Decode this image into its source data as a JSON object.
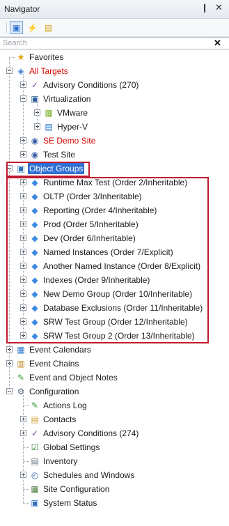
{
  "window": {
    "title": "Navigator",
    "pin_glyph": "❙",
    "close_glyph": "✕"
  },
  "toolbar": {
    "buttons": [
      {
        "name": "targets-view-icon",
        "glyph": "▣",
        "color": "#2b6fd0"
      },
      {
        "name": "lightning-icon",
        "glyph": "⚡",
        "color": "#e0a100"
      },
      {
        "name": "notes-icon",
        "glyph": "▤",
        "color": "#d9a21b"
      }
    ]
  },
  "search": {
    "placeholder": "Search",
    "clear_glyph": "✕"
  },
  "tree": [
    {
      "label": "Favorites",
      "icon": "favorites-icon",
      "glyph": "★",
      "glyph_color": "#e0a100"
    },
    {
      "label": "All Targets",
      "icon": "all-targets-icon",
      "glyph": "◈",
      "glyph_color": "#3a7bd5",
      "red": true
    },
    {
      "label": "Advisory Conditions (270)",
      "icon": "advisory-conditions-icon",
      "glyph": "✓",
      "glyph_color": "#7c4ca8"
    },
    {
      "label": "Virtualization",
      "icon": "virtualization-icon",
      "glyph": "▣",
      "glyph_color": "#2a5d9c"
    },
    {
      "label": "VMware",
      "icon": "vmware-icon",
      "glyph": "▦",
      "glyph_color": "#7bb12b"
    },
    {
      "label": "Hyper-V",
      "icon": "hyperv-icon",
      "glyph": "▤",
      "glyph_color": "#1e74c8"
    },
    {
      "label": "SE Demo Site",
      "icon": "site-icon",
      "glyph": "◉",
      "glyph_color": "#3b5fa8",
      "red": true
    },
    {
      "label": "Test Site",
      "icon": "site-icon",
      "glyph": "◉",
      "glyph_color": "#3b5fa8"
    },
    {
      "label": "Object Groups",
      "icon": "object-groups-icon",
      "glyph": "▣",
      "glyph_color": "#2d6fbf"
    },
    {
      "label": "Runtime Max Test (Order 2/Inheritable)",
      "icon": "object-group-icon",
      "glyph": "◆",
      "glyph_color": "#3d8be0"
    },
    {
      "label": "OLTP (Order 3/Inheritable)",
      "icon": "object-group-icon",
      "glyph": "◆",
      "glyph_color": "#3d8be0"
    },
    {
      "label": "Reporting (Order 4/Inheritable)",
      "icon": "object-group-icon",
      "glyph": "◆",
      "glyph_color": "#3d8be0"
    },
    {
      "label": "Prod (Order 5/Inheritable)",
      "icon": "object-group-icon",
      "glyph": "◆",
      "glyph_color": "#3d8be0"
    },
    {
      "label": "Dev (Order 6/Inheritable)",
      "icon": "object-group-icon",
      "glyph": "◆",
      "glyph_color": "#3d8be0"
    },
    {
      "label": "Named Instances (Order 7/Explicit)",
      "icon": "object-group-icon",
      "glyph": "◆",
      "glyph_color": "#3d8be0"
    },
    {
      "label": "Another Named Instance (Order 8/Explicit)",
      "icon": "object-group-icon",
      "glyph": "◆",
      "glyph_color": "#3d8be0"
    },
    {
      "label": "Indexes (Order 9/Inheritable)",
      "icon": "object-group-icon",
      "glyph": "◆",
      "glyph_color": "#3d8be0"
    },
    {
      "label": "New Demo Group (Order 10/Inheritable)",
      "icon": "object-group-icon",
      "glyph": "◆",
      "glyph_color": "#3d8be0"
    },
    {
      "label": "Database Exclusions (Order 11/Inheritable)",
      "icon": "object-group-icon",
      "glyph": "◆",
      "glyph_color": "#3d8be0"
    },
    {
      "label": "SRW Test Group (Order 12/Inheritable)",
      "icon": "object-group-icon",
      "glyph": "◆",
      "glyph_color": "#3d8be0"
    },
    {
      "label": "SRW Test Group 2 (Order 13/Inheritable)",
      "icon": "object-group-icon",
      "glyph": "◆",
      "glyph_color": "#3d8be0"
    },
    {
      "label": "Event Calendars",
      "icon": "event-calendars-icon",
      "glyph": "▦",
      "glyph_color": "#2f7fd1"
    },
    {
      "label": "Event Chains",
      "icon": "event-chains-icon",
      "glyph": "▥",
      "glyph_color": "#c48a2a"
    },
    {
      "label": "Event and Object Notes",
      "icon": "notes-icon",
      "glyph": "✎",
      "glyph_color": "#3a9a3a"
    },
    {
      "label": "Configuration",
      "icon": "configuration-icon",
      "glyph": "⚙",
      "glyph_color": "#5a6b7d"
    },
    {
      "label": "Actions Log",
      "icon": "actions-log-icon",
      "glyph": "✎",
      "glyph_color": "#3a9a3a"
    },
    {
      "label": "Contacts",
      "icon": "contacts-icon",
      "glyph": "▤",
      "glyph_color": "#d0a23a"
    },
    {
      "label": "Advisory Conditions (274)",
      "icon": "advisory-conditions-icon",
      "glyph": "✓",
      "glyph_color": "#7c4ca8"
    },
    {
      "label": "Global Settings",
      "icon": "global-settings-icon",
      "glyph": "☑",
      "glyph_color": "#3b8a3b"
    },
    {
      "label": "Inventory",
      "icon": "inventory-icon",
      "glyph": "▤",
      "glyph_color": "#6a7a8a"
    },
    {
      "label": "Schedules and Windows",
      "icon": "schedules-icon",
      "glyph": "◴",
      "glyph_color": "#3a6fc0"
    },
    {
      "label": "Site Configuration",
      "icon": "site-configuration-icon",
      "glyph": "▦",
      "glyph_color": "#4a7a3a"
    },
    {
      "label": "System Status",
      "icon": "system-status-icon",
      "glyph": "▣",
      "glyph_color": "#2f6fbf"
    }
  ]
}
